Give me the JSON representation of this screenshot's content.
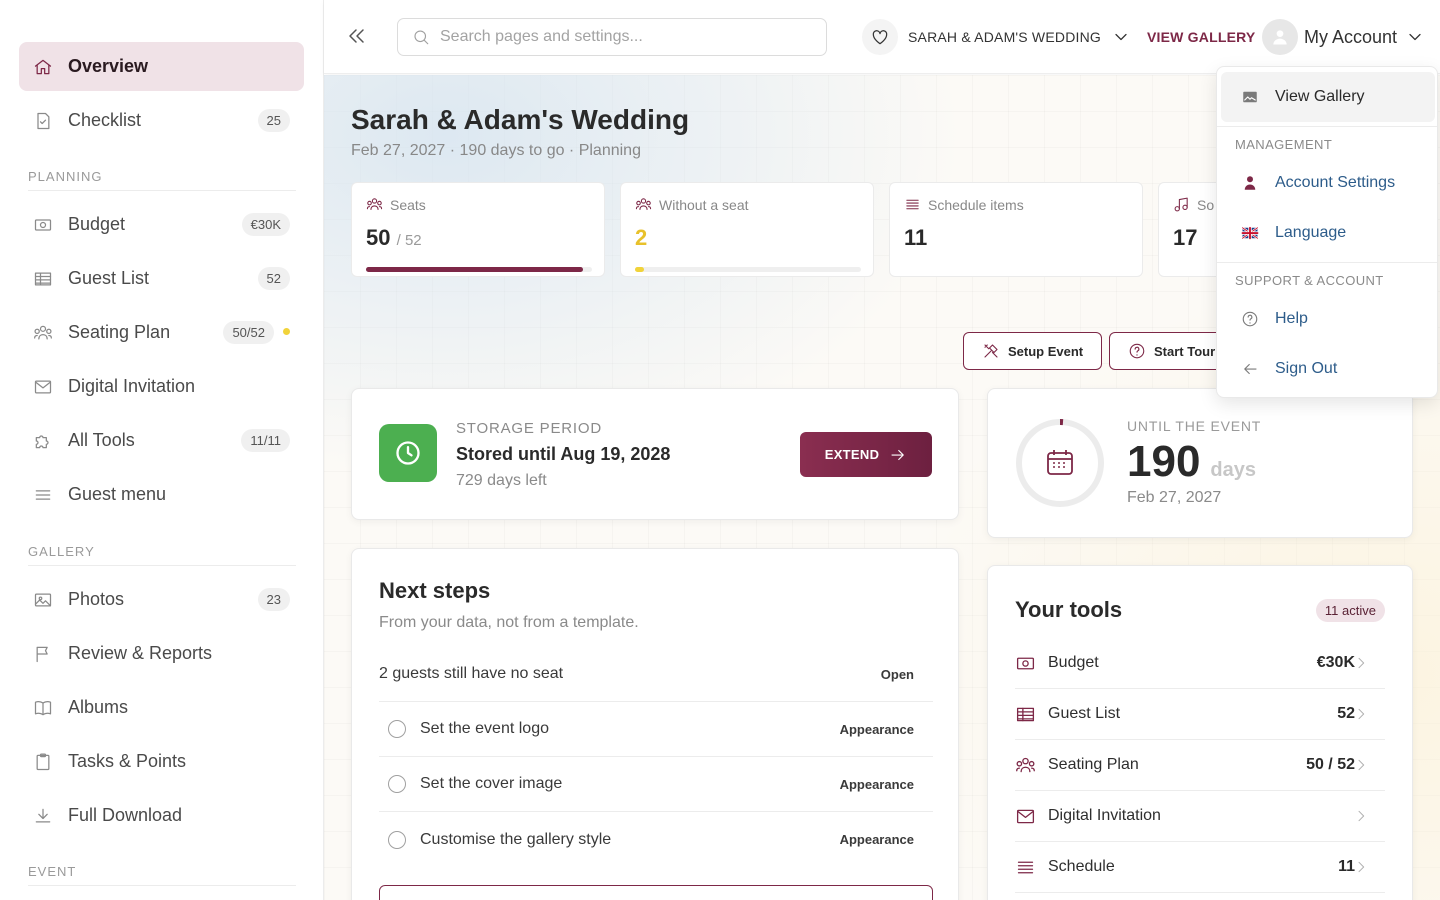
{
  "sidebar": {
    "top_items": [
      {
        "label": "Overview"
      },
      {
        "label": "Checklist",
        "badge": "25"
      }
    ],
    "sections": [
      {
        "heading": "PLANNING",
        "items": [
          {
            "label": "Budget",
            "badge": "€30K"
          },
          {
            "label": "Guest List",
            "badge": "52"
          },
          {
            "label": "Seating Plan",
            "badge": "50/52"
          },
          {
            "label": "Digital Invitation"
          },
          {
            "label": "All Tools",
            "badge": "11/11"
          },
          {
            "label": "Guest menu"
          }
        ]
      },
      {
        "heading": "GALLERY",
        "items": [
          {
            "label": "Photos",
            "badge": "23"
          },
          {
            "label": "Review & Reports"
          },
          {
            "label": "Albums"
          },
          {
            "label": "Tasks & Points"
          },
          {
            "label": "Full Download"
          }
        ]
      },
      {
        "heading": "EVENT"
      }
    ]
  },
  "topbar": {
    "search_placeholder": "Search pages and settings...",
    "event_name": "SARAH & ADAM'S WEDDING",
    "view_gallery": "VIEW GALLERY",
    "account_label": "My Account"
  },
  "header": {
    "title": "Sarah & Adam's Wedding",
    "subtitle": "Feb 27, 2027 · 190 days to go · Planning"
  },
  "stats": [
    {
      "label": "Seats",
      "value": "50",
      "total": "/ 52",
      "progress": 0.96
    },
    {
      "label": "Without a seat",
      "value": "2",
      "progress": 0.04
    },
    {
      "label": "Schedule items",
      "value": "11"
    },
    {
      "label": "So",
      "value": "17"
    }
  ],
  "actions": {
    "setup": "Setup Event",
    "tour": "Start Tour"
  },
  "storage": {
    "eyebrow": "STORAGE PERIOD",
    "title": "Stored until Aug 19, 2028",
    "days_left": "729 days left",
    "button": "EXTEND"
  },
  "countdown": {
    "eyebrow": "UNTIL THE EVENT",
    "number": "190",
    "unit": "days",
    "date": "Feb 27, 2027"
  },
  "next_steps": {
    "title": "Next steps",
    "subtitle": "From your data, not from a template.",
    "alert": {
      "text": "2 guests still have no seat",
      "action": "Open"
    },
    "items": [
      {
        "text": "Set the event logo",
        "action": "Appearance"
      },
      {
        "text": "Set the cover image",
        "action": "Appearance"
      },
      {
        "text": "Customise the gallery style",
        "action": "Appearance"
      }
    ]
  },
  "tools": {
    "title": "Your tools",
    "badge": "11 active",
    "items": [
      {
        "name": "Budget",
        "value": "€30K"
      },
      {
        "name": "Guest List",
        "value": "52"
      },
      {
        "name": "Seating Plan",
        "value": "50 / 52"
      },
      {
        "name": "Digital Invitation",
        "value": ""
      },
      {
        "name": "Schedule",
        "value": "11"
      }
    ]
  },
  "account_menu": {
    "view_gallery": "View Gallery",
    "management_heading": "MANAGEMENT",
    "account_settings": "Account Settings",
    "language": "Language",
    "support_heading": "SUPPORT & ACCOUNT",
    "help": "Help",
    "sign_out": "Sign Out"
  },
  "colors": {
    "accent": "#7d2847",
    "success": "#4caf50",
    "warning": "#f1d33a",
    "link": "#2d5c8a"
  }
}
